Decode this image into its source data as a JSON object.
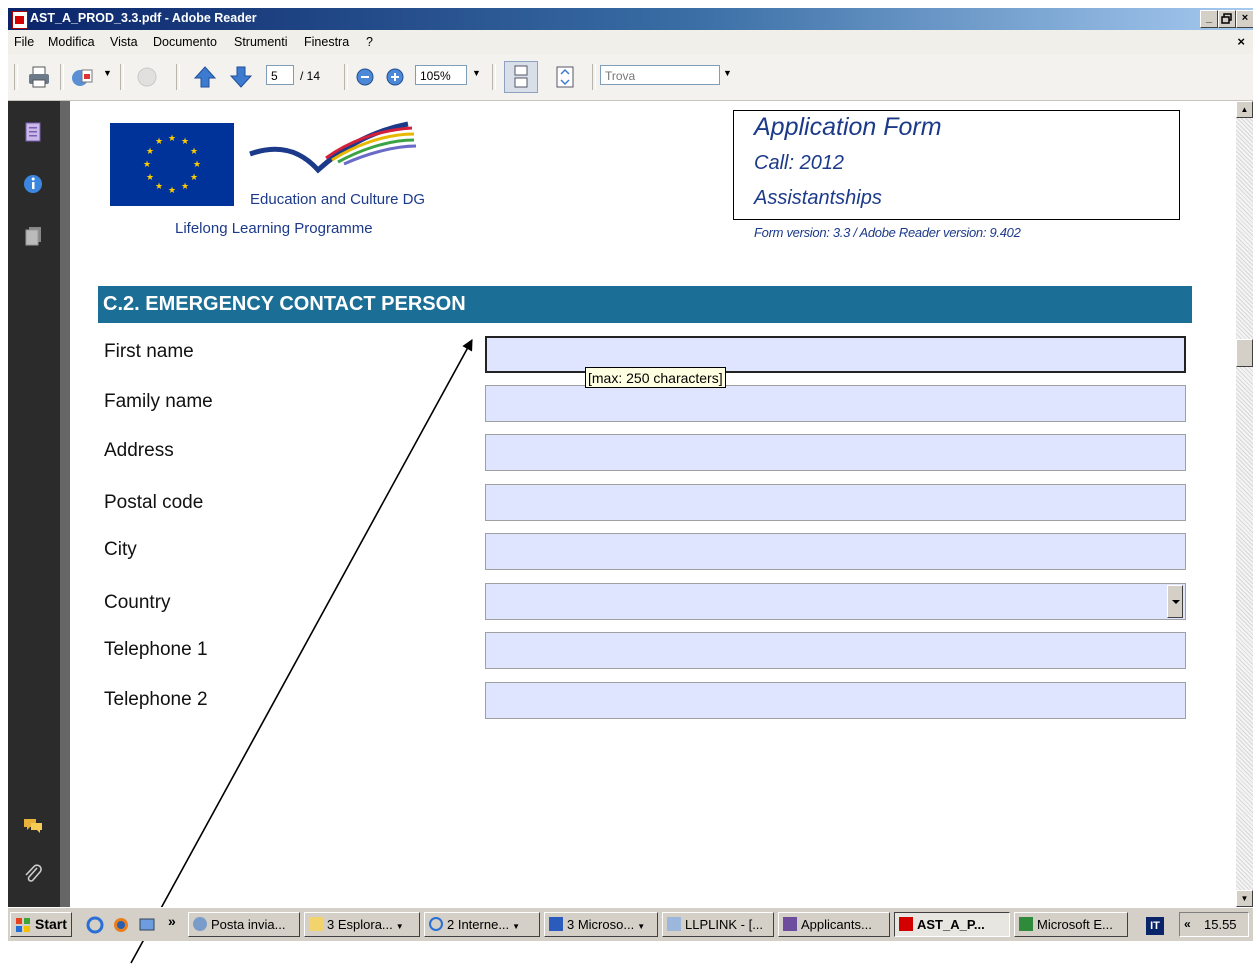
{
  "window": {
    "title": "AST_A_PROD_3.3.pdf - Adobe Reader",
    "controls": [
      "_",
      "×"
    ]
  },
  "menu": {
    "items": [
      "File",
      "Modifica",
      "Vista",
      "Documento",
      "Strumenti",
      "Finestra",
      "?"
    ],
    "close": "×"
  },
  "toolbar": {
    "page_current": "5",
    "page_total": "/ 14",
    "zoom": "105%",
    "find_placeholder": "Trova"
  },
  "document": {
    "org_name": "Education and Culture DG",
    "programme": "Lifelong Learning Programme",
    "form_title": "Application Form",
    "call": "Call: 2012",
    "action": "Assistantships",
    "form_version": "Form version: 3.3 / Adobe Reader version: 9.402",
    "section_title": "C.2. EMERGENCY CONTACT PERSON",
    "fields": [
      {
        "label": "First name",
        "value": ""
      },
      {
        "label": "Family name",
        "value": ""
      },
      {
        "label": "Address",
        "value": ""
      },
      {
        "label": "Postal code",
        "value": ""
      },
      {
        "label": "City",
        "value": ""
      },
      {
        "label": "Country",
        "value": ""
      },
      {
        "label": "Telephone 1",
        "value": ""
      },
      {
        "label": "Telephone 2",
        "value": ""
      }
    ],
    "tooltip": "[max: 250 characters]"
  },
  "taskbar": {
    "start": "Start",
    "chevron": "»",
    "tasks": [
      {
        "label": "Posta invia..."
      },
      {
        "label": "3 Esplora..."
      },
      {
        "label": "2 Interne..."
      },
      {
        "label": "3 Microso..."
      },
      {
        "label": "LLPLINK - [..."
      },
      {
        "label": "Applicants..."
      },
      {
        "label": "AST_A_P..."
      },
      {
        "label": "Microsoft E..."
      }
    ],
    "language": "IT",
    "tray_chevron": "«",
    "clock": "15.55"
  },
  "colors": {
    "section_header": "#1b6e95",
    "field_fill": "#dfe4ff",
    "title_text": "#1c3a8a"
  }
}
